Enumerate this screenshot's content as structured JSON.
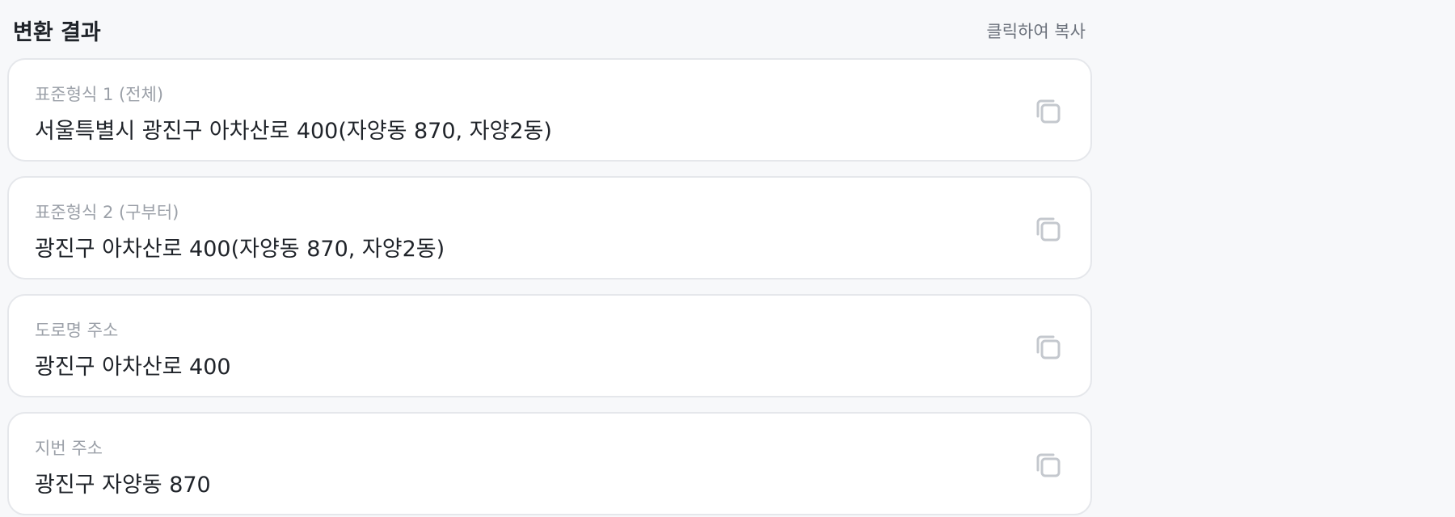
{
  "header": {
    "title": "변환 결과",
    "copy_hint": "클릭하여 복사"
  },
  "icons": {
    "copy": "copy-icon"
  },
  "colors": {
    "page_background": "#f7f8fa",
    "card_background": "#ffffff",
    "card_border": "#e5e7eb",
    "primary_text": "#1f2329",
    "label_text": "#9ba0a8",
    "icon": "#c4c8ce"
  },
  "results": [
    {
      "label": "표준형식 1 (전체)",
      "value": "서울특별시 광진구 아차산로 400(자양동 870, 자양2동)"
    },
    {
      "label": "표준형식 2 (구부터)",
      "value": "광진구 아차산로 400(자양동 870, 자양2동)"
    },
    {
      "label": "도로명 주소",
      "value": "광진구 아차산로 400"
    },
    {
      "label": "지번 주소",
      "value": "광진구 자양동 870"
    }
  ]
}
